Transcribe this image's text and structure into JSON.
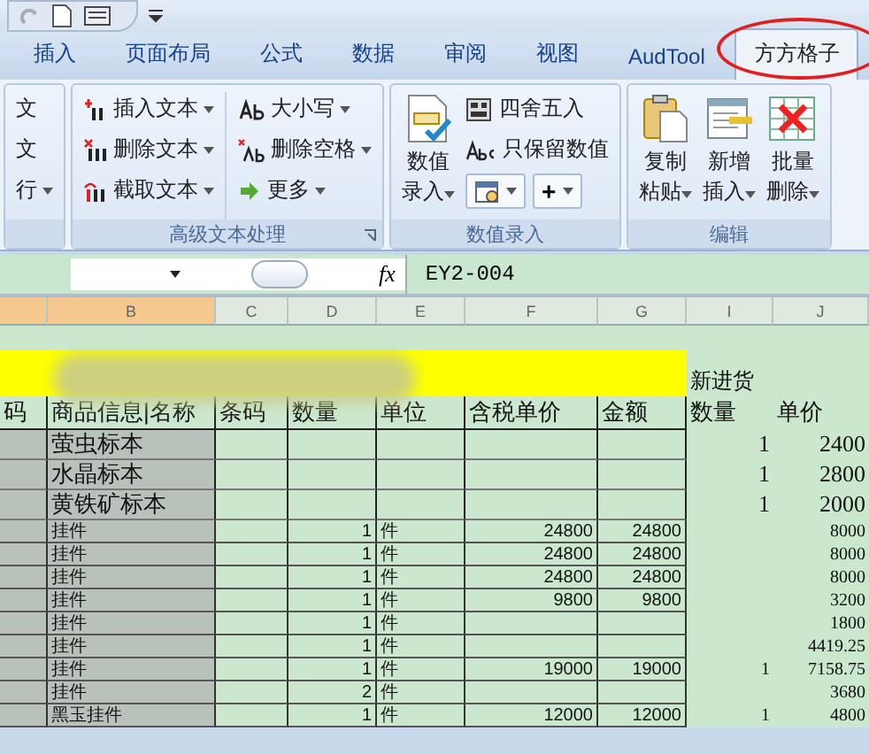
{
  "tabs": [
    {
      "label": "插入",
      "selected": false,
      "circled": false
    },
    {
      "label": "页面布局",
      "selected": false,
      "circled": false
    },
    {
      "label": "公式",
      "selected": false,
      "circled": false
    },
    {
      "label": "数据",
      "selected": false,
      "circled": false
    },
    {
      "label": "审阅",
      "selected": false,
      "circled": false
    },
    {
      "label": "视图",
      "selected": false,
      "circled": false
    },
    {
      "label": "AudTool",
      "selected": false,
      "circled": false
    },
    {
      "label": "方方格子",
      "selected": true,
      "circled": true
    }
  ],
  "ribbon_groups": [
    {
      "columns": [
        [
          {
            "kind": "small",
            "label": "文",
            "dropdown": false
          },
          {
            "kind": "small",
            "label": "文",
            "dropdown": false
          },
          {
            "kind": "small",
            "label": "行",
            "dropdown": true
          }
        ]
      ]
    },
    {
      "title": "高级文本处理",
      "launcher": true,
      "columns": [
        [
          {
            "kind": "small",
            "label": "插入文本",
            "dropdown": true
          },
          {
            "kind": "small",
            "label": "删除文本",
            "dropdown": true
          },
          {
            "kind": "small",
            "label": "截取文本",
            "dropdown": true
          }
        ],
        [
          {
            "kind": "small",
            "label": "大小写",
            "dropdown": true
          },
          {
            "kind": "small",
            "label": "删除空格",
            "dropdown": true
          },
          {
            "kind": "small",
            "label": "更多",
            "dropdown": true
          }
        ]
      ]
    },
    {
      "title": "数值录入",
      "launcher": false,
      "columns": [
        [
          {
            "kind": "large",
            "lines": [
              "数值",
              "录入"
            ],
            "dropdown": true
          }
        ],
        [
          {
            "kind": "small",
            "label": "四舍五入",
            "dropdown": false
          },
          {
            "kind": "small",
            "label": "只保留数值",
            "dropdown": false
          },
          {
            "kind": "pair",
            "symbol": "+"
          }
        ]
      ]
    },
    {
      "title": "编辑",
      "launcher": false,
      "columns": [
        [
          {
            "kind": "large",
            "lines": [
              "复制",
              "粘贴"
            ],
            "dropdown": true
          }
        ],
        [
          {
            "kind": "large",
            "lines": [
              "新增",
              "插入"
            ],
            "dropdown": true
          }
        ],
        [
          {
            "kind": "large",
            "lines": [
              "批量",
              "删除"
            ],
            "dropdown": true
          }
        ]
      ]
    }
  ],
  "formula_bar": {
    "function_label": "fx",
    "formula": "EY2-004"
  },
  "columns": [
    {
      "label": "B",
      "selected": true
    },
    {
      "label": "C",
      "selected": false
    },
    {
      "label": "D",
      "selected": false
    },
    {
      "label": "E",
      "selected": false
    },
    {
      "label": "F",
      "selected": false
    },
    {
      "label": "G",
      "selected": false
    },
    {
      "label": "I",
      "selected": false
    },
    {
      "label": "J",
      "selected": false
    }
  ],
  "rows": [
    {
      "kind": "blank",
      "cells": [
        null,
        null,
        null,
        null,
        null,
        null,
        null,
        null,
        null
      ]
    },
    {
      "kind": "banner",
      "cells": [
        null,
        null,
        null,
        null,
        null,
        null,
        null,
        "新进货",
        null
      ]
    },
    {
      "kind": "header",
      "cells": [
        "码",
        "商品信息|名称",
        "条码",
        "数量",
        "单位",
        "含税单价",
        "金额",
        "数量",
        "单价"
      ]
    },
    {
      "kind": "tall",
      "cells": [
        null,
        "萤虫标本",
        null,
        null,
        null,
        null,
        null,
        "1",
        "2400"
      ]
    },
    {
      "kind": "tall",
      "cells": [
        null,
        "水晶标本",
        null,
        null,
        null,
        null,
        null,
        "1",
        "2800"
      ]
    },
    {
      "kind": "tall",
      "cells": [
        null,
        "黄铁矿标本",
        null,
        null,
        null,
        null,
        null,
        "1",
        "2000"
      ]
    },
    {
      "kind": "data",
      "cells": [
        null,
        "挂件",
        null,
        "1",
        "件",
        "24800",
        "24800",
        null,
        "8000"
      ]
    },
    {
      "kind": "data",
      "cells": [
        null,
        "挂件",
        null,
        "1",
        "件",
        "24800",
        "24800",
        null,
        "8000"
      ]
    },
    {
      "kind": "data",
      "cells": [
        null,
        "挂件",
        null,
        "1",
        "件",
        "24800",
        "24800",
        null,
        "8000"
      ]
    },
    {
      "kind": "data",
      "cells": [
        null,
        "挂件",
        null,
        "1",
        "件",
        "9800",
        "9800",
        null,
        "3200"
      ]
    },
    {
      "kind": "data",
      "cells": [
        null,
        "挂件",
        null,
        "1",
        "件",
        null,
        null,
        null,
        "1800"
      ]
    },
    {
      "kind": "data",
      "cells": [
        null,
        "挂件",
        null,
        "1",
        "件",
        null,
        null,
        null,
        "4419.25"
      ]
    },
    {
      "kind": "data",
      "cells": [
        null,
        "挂件",
        null,
        "1",
        "件",
        "19000",
        "19000",
        "1",
        "7158.75"
      ]
    },
    {
      "kind": "data",
      "cells": [
        null,
        "挂件",
        null,
        "2",
        "件",
        null,
        null,
        null,
        "3680"
      ]
    },
    {
      "kind": "data",
      "cells": [
        null,
        "黑玉挂件",
        null,
        "1",
        "件",
        "12000",
        "12000",
        "1",
        "4800"
      ]
    }
  ]
}
